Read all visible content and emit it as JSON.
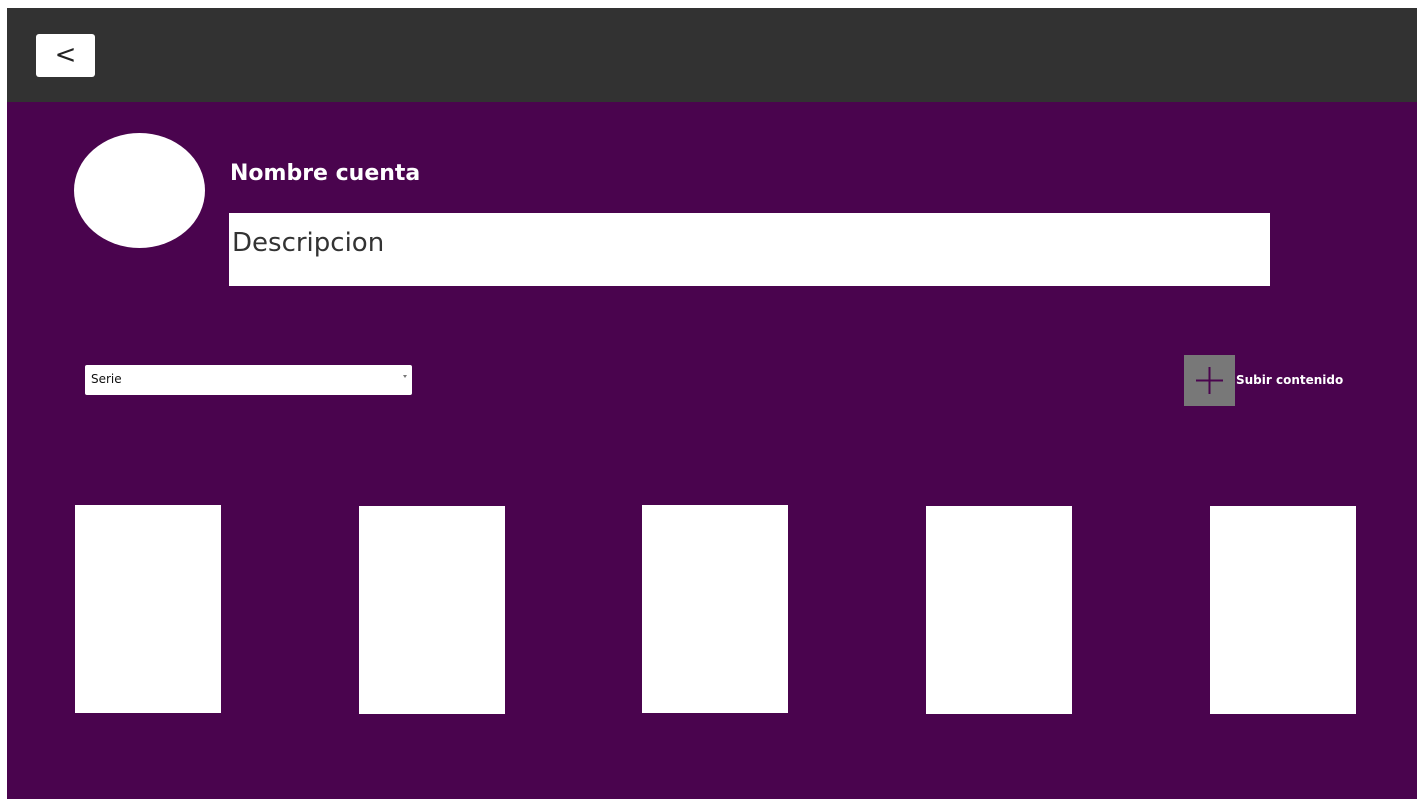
{
  "header": {
    "back_label": "<"
  },
  "profile": {
    "account_name": "Nombre cuenta",
    "description_placeholder": "Descripcion"
  },
  "filter": {
    "selected_value": "Serie"
  },
  "upload": {
    "icon": "plus-icon",
    "label": "Subir contenido"
  },
  "content": {
    "cards": [
      "",
      "",
      "",
      "",
      ""
    ]
  },
  "colors": {
    "background": "#4a044e",
    "topbar": "#323232",
    "upload_icon_bg": "#787878",
    "plus_stroke": "#4a044e",
    "surface": "#ffffff"
  }
}
